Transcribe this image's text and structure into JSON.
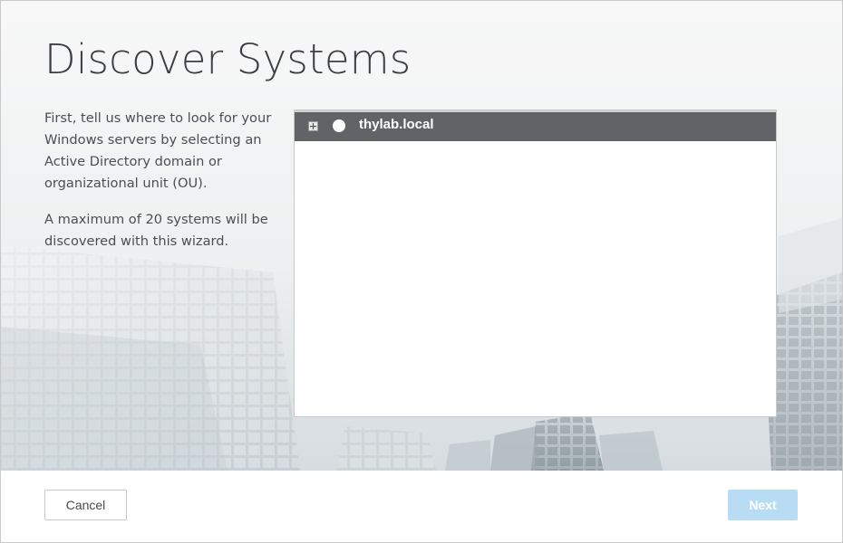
{
  "page": {
    "title": "Discover Systems",
    "description_1": "First, tell us where to look for your Windows servers by selecting an Active Directory domain or organizational unit (OU).",
    "description_2": "A maximum of 20 systems will be discovered with this wizard."
  },
  "tree": {
    "items": [
      {
        "label": "thylab.local",
        "selected": false,
        "expanded": false
      }
    ]
  },
  "footer": {
    "cancel_label": "Cancel",
    "next_label": "Next",
    "next_enabled": false
  },
  "colors": {
    "tree_row_bg": "#616367",
    "next_disabled_bg": "#b9dcf5",
    "title_text": "#3b3f45"
  }
}
